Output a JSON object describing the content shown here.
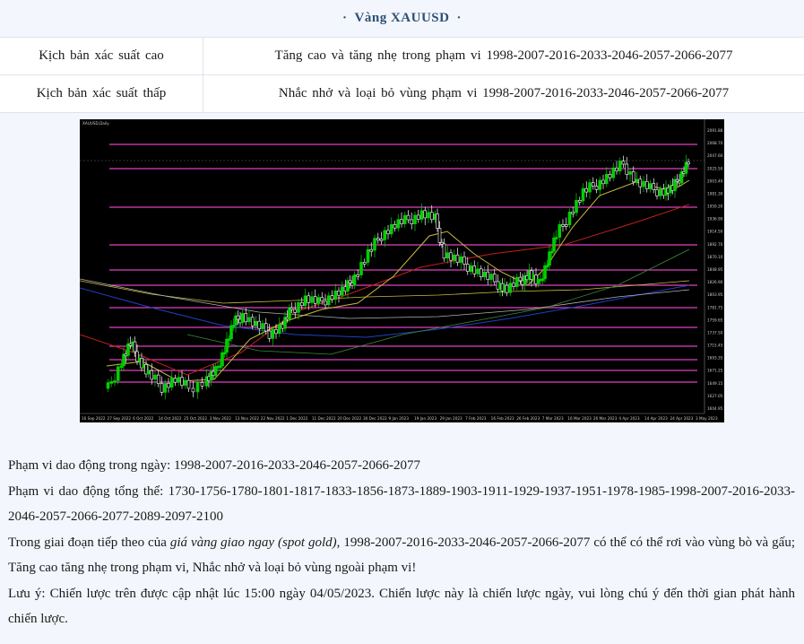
{
  "header": {
    "title": "Vàng XAUUSD",
    "dot": "·"
  },
  "scenarios": [
    {
      "label": "Kịch bản xác suất cao",
      "value": "Tăng cao và tăng nhẹ trong phạm vi 1998-2007-2016-2033-2046-2057-2066-2077"
    },
    {
      "label": "Kịch bản xác suất thấp",
      "value": "Nhắc nhở và loại bỏ vùng phạm vi 1998-2007-2016-2033-2046-2057-2066-2077"
    }
  ],
  "chart": {
    "symbol_label": "XAUUSD,Daily",
    "price_ticks": [
      "2091.88",
      "2068.70",
      "2047.60",
      "2025.50",
      "2003.40",
      "1981.30",
      "1959.20",
      "1936.90",
      "1914.50",
      "1892.70",
      "1870.10",
      "1848.95",
      "1826.90",
      "1803.95",
      "1781.75",
      "1759.65",
      "1737.50",
      "1715.45",
      "1693.35",
      "1671.25",
      "1649.15",
      "1627.05",
      "1604.95"
    ],
    "time_ticks": [
      "16 Sep 2022",
      "27 Sep 2022",
      "6 Oct 2022",
      "14 Oct 2022",
      "25 Oct 2022",
      "3 Nov 2022",
      "13 Nov 2022",
      "22 Nov 2022",
      "1 Dec 2022",
      "11 Dec 2022",
      "20 Dec 2022",
      "30 Dec 2022",
      "9 Jan 2023",
      "19 Jan 2023",
      "29 Jan 2023",
      "7 Feb 2023",
      "16 Feb 2023",
      "26 Feb 2023",
      "7 Mar 2023",
      "16 Mar 2023",
      "26 Mar 2023",
      "4 Apr 2023",
      "14 Apr 2023",
      "24 Apr 2023",
      "3 May 2023"
    ],
    "colors": {
      "bg": "#000000",
      "bull": "#00d000",
      "bear": "#ffffff",
      "level": "#e040c0",
      "ma_yellow": "#c8b840",
      "ma_red": "#c02020",
      "ma_green": "#3a8a3a",
      "ma_blue": "#2040c0",
      "ma_white": "#b0b0b0"
    }
  },
  "paragraphs": {
    "daily": "Phạm vi dao động trong ngày: 1998-2007-2016-2033-2046-2057-2066-2077",
    "overall": "Phạm vi dao động tổng thể: 1730-1756-1780-1801-1817-1833-1856-1873-1889-1903-1911-1929-1937-1951-1978-1985-1998-2007-2016-2033-2046-2057-2066-2077-2089-2097-2100",
    "next_pre": "Trong giai đoạn tiếp theo của ",
    "next_em": "giá vàng giao ngay (spot gold)",
    "next_post": ", 1998-2007-2016-2033-2046-2057-2066-2077 có thể có thể rơi vào vùng bò và gấu; Tăng cao tăng nhẹ trong phạm vi, Nhắc nhở và loại bỏ vùng ngoài phạm vi!",
    "note": "Lưu ý: Chiến lược trên được cập nhật lúc 15:00 ngày 04/05/2023. Chiến lược này là chiến lược ngày, vui lòng chú ý đến thời gian phát hành chiến lược."
  }
}
